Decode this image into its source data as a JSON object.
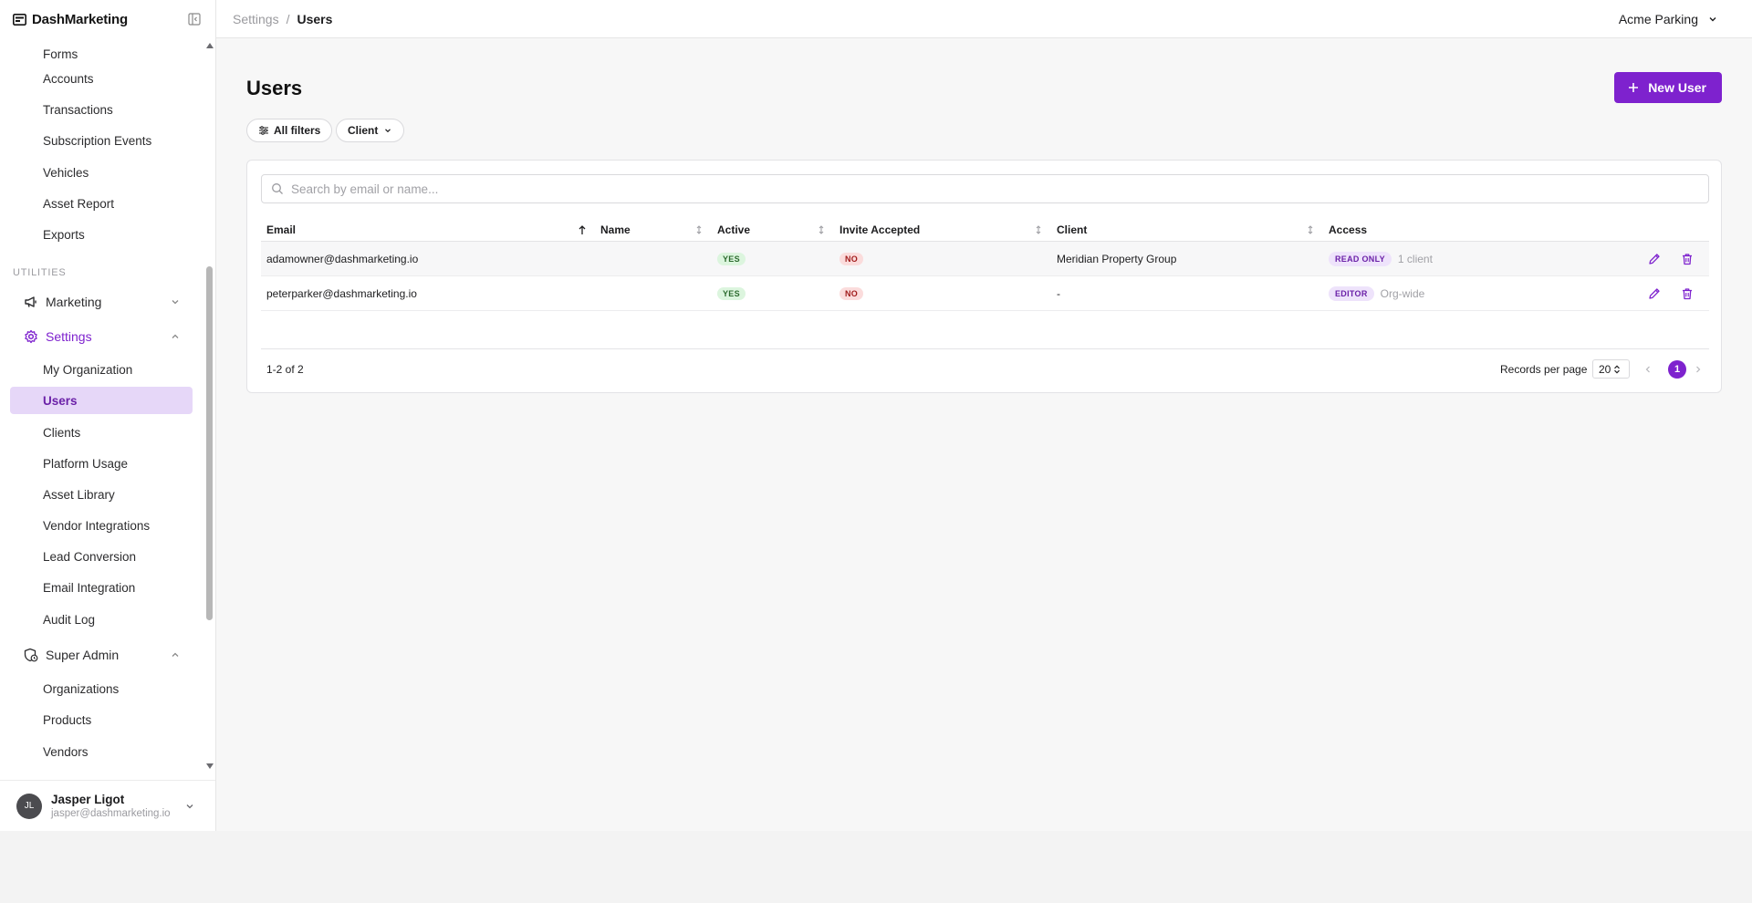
{
  "brand": {
    "name": "DashMarketing"
  },
  "nav": {
    "items_top": [
      "Forms",
      "Accounts",
      "Transactions",
      "Subscription Events",
      "Vehicles",
      "Asset Report",
      "Exports"
    ],
    "section_utilities": "UTILITIES",
    "marketing": "Marketing",
    "settings": "Settings",
    "settings_items": [
      "My Organization",
      "Users",
      "Clients",
      "Platform Usage",
      "Asset Library",
      "Vendor Integrations",
      "Lead Conversion",
      "Email Integration",
      "Audit Log"
    ],
    "super_admin": "Super Admin",
    "super_admin_items": [
      "Organizations",
      "Products",
      "Vendors"
    ]
  },
  "user": {
    "name": "Jasper Ligot",
    "email": "jasper@dashmarketing.io",
    "initials": "JL"
  },
  "breadcrumb": {
    "parent": "Settings",
    "separator": "/",
    "current": "Users"
  },
  "org": {
    "name": "Acme Parking"
  },
  "page": {
    "title": "Users",
    "new_button": "New User"
  },
  "filters": {
    "all": "All filters",
    "client": "Client"
  },
  "search": {
    "placeholder": "Search by email or name..."
  },
  "table": {
    "columns": [
      "Email",
      "Name",
      "Active",
      "Invite Accepted",
      "Client",
      "Access"
    ],
    "rows": [
      {
        "email": "adamowner@dashmarketing.io",
        "name": "",
        "active": "YES",
        "invite": "NO",
        "client": "Meridian Property Group",
        "access": "READ ONLY",
        "access_sub": "1 client"
      },
      {
        "email": "peterparker@dashmarketing.io",
        "name": "",
        "active": "YES",
        "invite": "NO",
        "client": "-",
        "access": "EDITOR",
        "access_sub": "Org-wide"
      }
    ]
  },
  "pagination": {
    "count": "1-2 of 2",
    "records_label": "Records per page",
    "per_page": "20",
    "current_page": "1"
  },
  "colors": {
    "accent": "#7e22ce",
    "active_nav_bg": "#e6d7f8"
  }
}
